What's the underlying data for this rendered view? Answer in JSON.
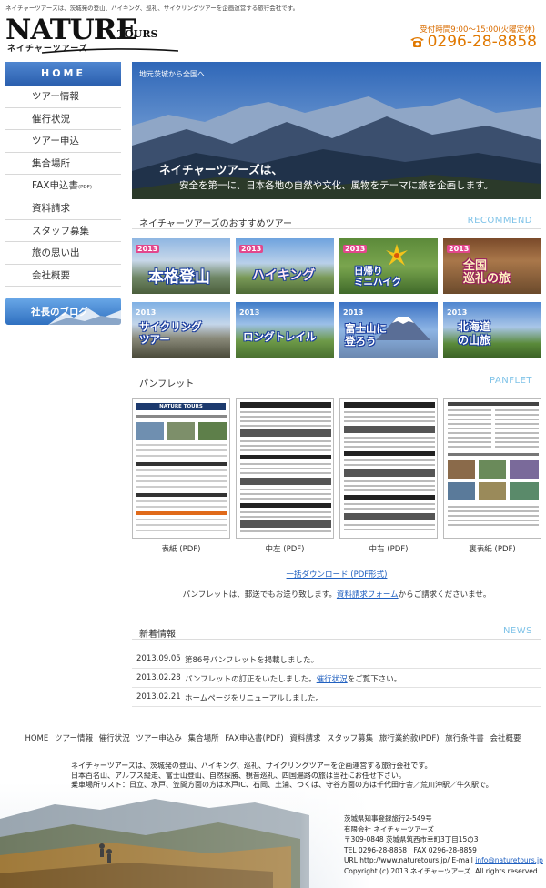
{
  "header": {
    "note": "ネイチャーツアーズは、茨城発の登山、ハイキング、巡礼、サイクリングツアーを企画運営する旅行会社です。",
    "logo_main": "NATURE",
    "logo_tours": "TOURS",
    "logo_kana": "ネイチャーツアーズ",
    "hours": "受付時間9:00〜15:00(火曜定休)",
    "phone": "0296-28-8858"
  },
  "sidebar": {
    "home": "HOME",
    "items": [
      {
        "label": "ツアー情報"
      },
      {
        "label": "催行状況"
      },
      {
        "label": "ツアー申込"
      },
      {
        "label": "集合場所"
      },
      {
        "label": "FAX申込書",
        "sub": "(PDF)"
      },
      {
        "label": "資料請求"
      },
      {
        "label": "スタッフ募集"
      },
      {
        "label": "旅の思い出"
      },
      {
        "label": "会社概要"
      }
    ],
    "blog": "社長のブログ"
  },
  "hero": {
    "tag": "地元茨城から全国へ",
    "heading": "ネイチャーツアーズは、",
    "sub": "安全を第一に、日本各地の自然や文化、風物をテーマに旅を企画します。"
  },
  "recommend": {
    "title": "ネイチャーツアーズのおすすめツアー",
    "en": "RECOMMEND",
    "tours": [
      {
        "year": "2013",
        "label": "本格登山"
      },
      {
        "year": "2013",
        "label": "ハイキング"
      },
      {
        "year": "2013",
        "label": "日帰り\nミニハイク"
      },
      {
        "year": "2013",
        "label": "全国\n巡礼の旅"
      },
      {
        "year": "2013",
        "label": "サイクリング\nツアー"
      },
      {
        "year": "2013",
        "label": "ロングトレイル"
      },
      {
        "year": "2013",
        "label": "富士山に\n登ろう"
      },
      {
        "year": "2013",
        "label": "北海道\nの山旅"
      }
    ]
  },
  "pamphlet": {
    "title": "パンフレット",
    "en": "PANFLET",
    "cover_title": "NATURE TOURS",
    "captions": [
      "表紙 (PDF)",
      "中左 (PDF)",
      "中右 (PDF)",
      "裏表紙 (PDF)"
    ],
    "download": "一括ダウンロード (PDF形式)",
    "note_before": "パンフレットは、郵送でもお送り致します。",
    "note_link": "資料請求フォーム",
    "note_after": "からご請求くださいませ。"
  },
  "news": {
    "title": "新着情報",
    "en": "NEWS",
    "items": [
      {
        "date": "2013.09.05",
        "text": "第86号パンフレットを掲載しました。"
      },
      {
        "date": "2013.02.28",
        "text": "パンフレットの訂正をいたしました。",
        "link": "催行状況",
        "after": "をご覧下さい。"
      },
      {
        "date": "2013.02.21",
        "text": "ホームページをリニューアルしました。"
      }
    ]
  },
  "footer": {
    "links": [
      "HOME",
      "ツアー情報",
      "催行状況",
      "ツアー申込み",
      "集合場所",
      "FAX申込書(PDF)",
      "資料請求",
      "スタッフ募集",
      "旅行業約款(PDF)",
      "旅行条件書",
      "会社概要"
    ],
    "desc": [
      "ネイチャーツアーズは、茨城発の登山、ハイキング、巡礼、サイクリングツアーを企画運営する旅行会社です。",
      "日本百名山、アルプス縦走、富士山登山、自然探勝、観音巡礼、四国遍路の旅は当社にお任せ下さい。",
      "乗車場所リスト：日立、水戸、笠間方面の方は水戸IC、石岡、土浦、つくば、守谷方面の方は千代田庁舎／荒川沖駅／牛久駅で。"
    ],
    "info": [
      "茨城県知事登録旅行2-549号",
      "有限会社 ネイチャーツアーズ",
      "〒309-0848 茨城県筑西市幸町3丁目15の3",
      "TEL 0296-28-8858　FAX 0296-28-8859"
    ],
    "url_line": "URL http://www.naturetours.jp/ E-mail ",
    "email": "info@naturetours.jp",
    "copyright": "Copyright (c) 2013 ネイチャーツアーズ. All rights reserved."
  }
}
